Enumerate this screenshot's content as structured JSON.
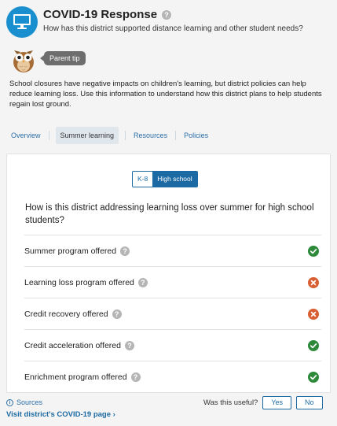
{
  "header": {
    "title": "COVID-19 Response",
    "subtitle": "How has this district supported distance learning and other student needs?"
  },
  "tip": {
    "label": "Parent tip",
    "description": "School closures have negative impacts on children's learning, but district policies can help reduce learning loss. Use this information to understand how this district plans to help students regain lost ground."
  },
  "tabs": [
    {
      "label": "Overview",
      "active": false
    },
    {
      "label": "Summer learning",
      "active": true
    },
    {
      "label": "Resources",
      "active": false
    },
    {
      "label": "Policies",
      "active": false
    }
  ],
  "level_toggle": {
    "options": [
      "K-8",
      "High school"
    ],
    "selected": "High school"
  },
  "question": "How is this district addressing learning loss over summer for high school students?",
  "programs": [
    {
      "label": "Summer program offered",
      "offered": true
    },
    {
      "label": "Learning loss program offered",
      "offered": false
    },
    {
      "label": "Credit recovery offered",
      "offered": false
    },
    {
      "label": "Credit acceleration offered",
      "offered": true
    },
    {
      "label": "Enrichment program offered",
      "offered": true
    }
  ],
  "footer": {
    "sources_label": "Sources",
    "visit_label": "Visit district's COVID-19 page",
    "useful_label": "Was this useful?",
    "yes_label": "Yes",
    "no_label": "No"
  },
  "colors": {
    "accent": "#1b6aa3",
    "badge": "#1a8fd0",
    "yes": "#2d8a3a",
    "no": "#d95f33"
  },
  "icons": {
    "header": "computer-monitor-icon",
    "tip": "owl-icon",
    "yes": "check-icon",
    "no": "x-icon"
  }
}
